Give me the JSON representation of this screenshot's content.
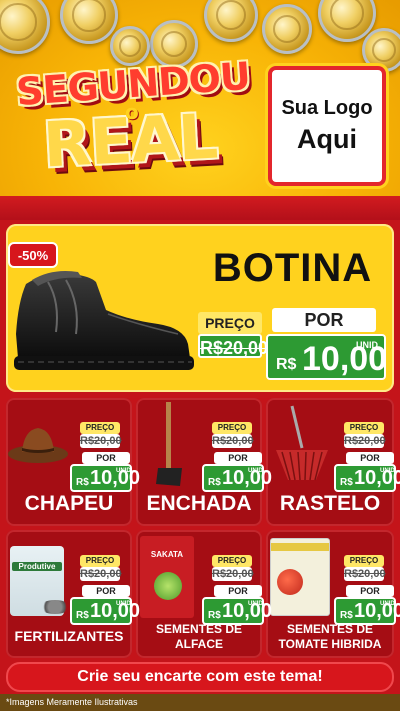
{
  "header": {
    "title_line1": "SEGUNDOU",
    "title_connector": "o",
    "title_line2": "REAL",
    "logo_line1": "Sua Logo",
    "logo_line2": "Aqui"
  },
  "featured": {
    "discount": "-50%",
    "name": "BOTINA",
    "price_label": "PREÇO",
    "old_price": "R$20,00",
    "new_label": "POR",
    "currency": "R$",
    "new_price": "10,00",
    "unit": "UNID"
  },
  "products": [
    {
      "name": "CHAPEU",
      "price_label": "PREÇO",
      "old_price": "R$20,00",
      "new_label": "POR",
      "currency": "R$",
      "new_price": "10,00",
      "unit": "UNID"
    },
    {
      "name": "ENCHADA",
      "price_label": "PREÇO",
      "old_price": "R$20,00",
      "new_label": "POR",
      "currency": "R$",
      "new_price": "10,00",
      "unit": "UNID"
    },
    {
      "name": "RASTELO",
      "price_label": "PREÇO",
      "old_price": "R$20,00",
      "new_label": "POR",
      "currency": "R$",
      "new_price": "10,00",
      "unit": "UNID"
    },
    {
      "name": "FERTILIZANTES",
      "price_label": "PREÇO",
      "old_price": "R$20,00",
      "new_label": "POR",
      "currency": "R$",
      "new_price": "10,00",
      "unit": "UNID",
      "pack_text": "Produtive"
    },
    {
      "name_line1": "SEMENTES DE",
      "name_line2": "ALFACE",
      "price_label": "PREÇO",
      "old_price": "R$20,00",
      "new_label": "POR",
      "currency": "R$",
      "new_price": "10,00",
      "unit": "UNID",
      "pack_text": "SAKATA"
    },
    {
      "name_line1": "SEMENTES DE",
      "name_line2": "TOMATE HIBRIDA",
      "price_label": "PREÇO",
      "old_price": "R$20,00",
      "new_label": "POR",
      "currency": "R$",
      "new_price": "10,00",
      "unit": "UNID"
    }
  ],
  "cta_label": "Crie seu encarte com este tema!",
  "footer_note": "*Imagens Meramente Ilustrativas",
  "colors": {
    "red": "#c4141a",
    "yellow": "#ffd21e",
    "green": "#2d9a33"
  }
}
